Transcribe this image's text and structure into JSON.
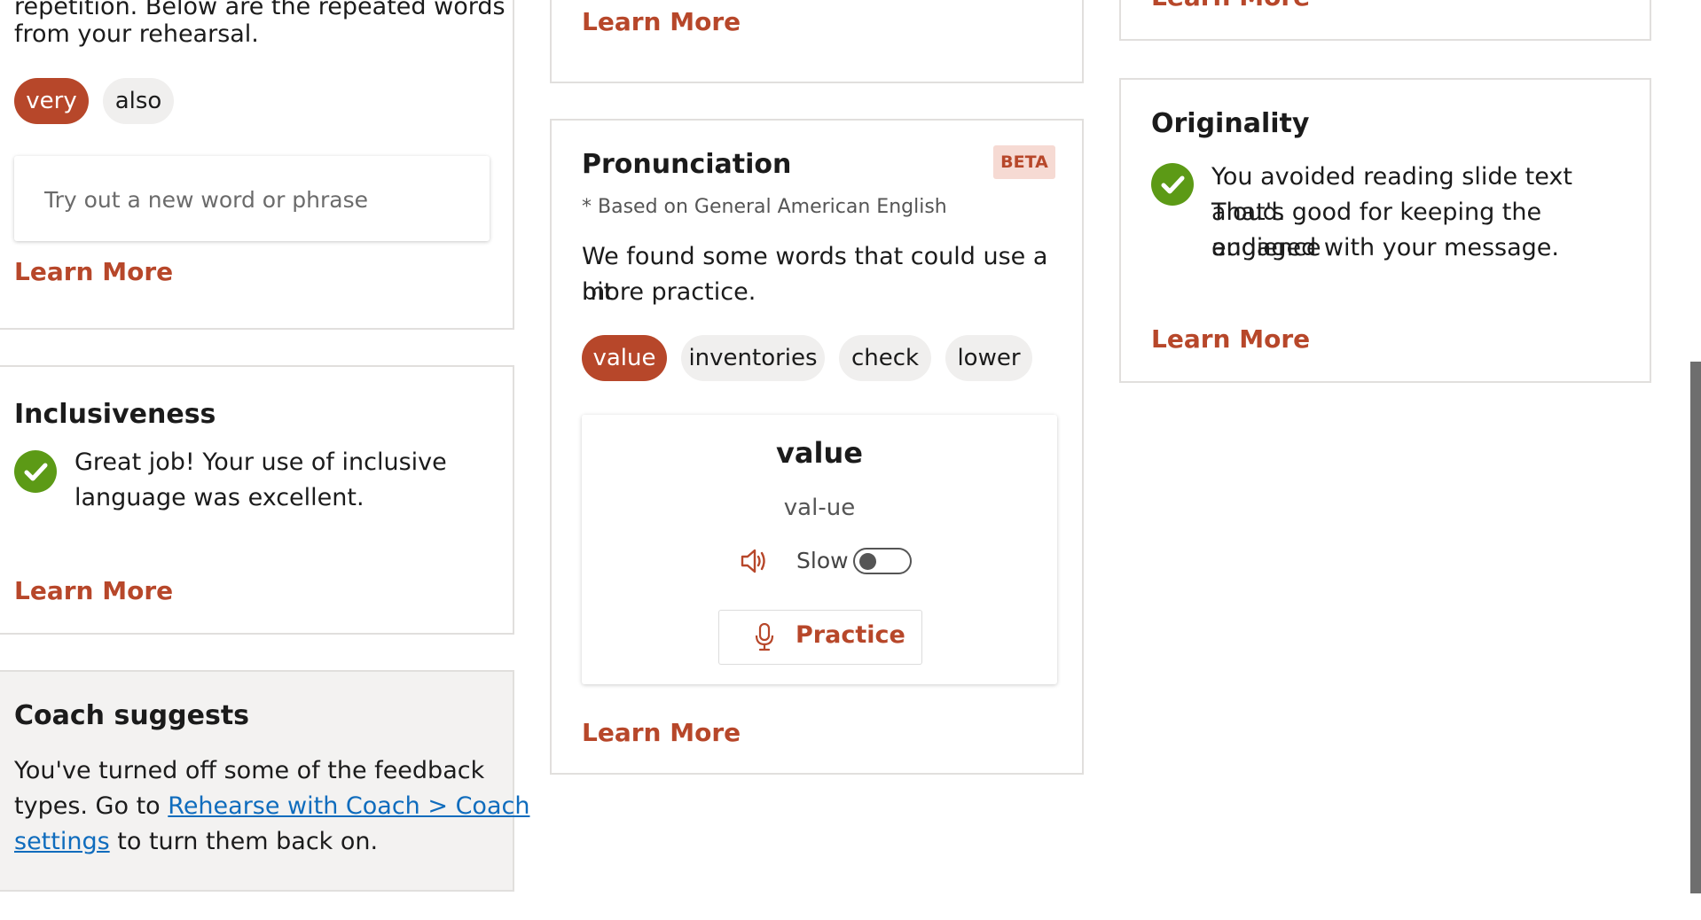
{
  "repetitive": {
    "intro_line1": "repetition. Below are the repeated words",
    "intro_line2": "from your rehearsal.",
    "words": [
      "very",
      "also"
    ],
    "input_placeholder": "Try out a new word or phrase",
    "learn_more": "Learn More"
  },
  "inclusiveness": {
    "title": "Inclusiveness",
    "message_line1": "Great job! Your use of inclusive",
    "message_line2": "language was excellent.",
    "learn_more": "Learn More"
  },
  "coach_suggests": {
    "title": "Coach suggests",
    "line1": "You've turned off some of the feedback",
    "line2_prefix": "types. Go to ",
    "link_part1": "Rehearse with Coach > Coach",
    "link_part2": "settings",
    "line3_suffix": " to turn them back on."
  },
  "top_middle": {
    "learn_more": "Learn More"
  },
  "top_right": {
    "learn_more": "Learn More"
  },
  "pronunciation": {
    "title": "Pronunciation",
    "badge": "BETA",
    "subtitle": "* Based on General American English",
    "message_line1": "We found some words that could use a bit",
    "message_line2": "more practice.",
    "words": [
      "value",
      "inventories",
      "check",
      "lower"
    ],
    "selected_word": "value",
    "syllables": "val-ue",
    "slow_label": "Slow",
    "slow_enabled": false,
    "practice_label": "Practice",
    "learn_more": "Learn More"
  },
  "originality": {
    "title": "Originality",
    "message_line1": "You avoided reading slide text aloud.",
    "message_line2": "That's good for keeping the audience",
    "message_line3": "engaged with your message.",
    "learn_more": "Learn More"
  },
  "colors": {
    "accent": "#b7472a",
    "success": "#5c9a16",
    "link": "#0f6cbd"
  },
  "icons": [
    "check-icon",
    "speaker-icon",
    "microphone-icon"
  ]
}
